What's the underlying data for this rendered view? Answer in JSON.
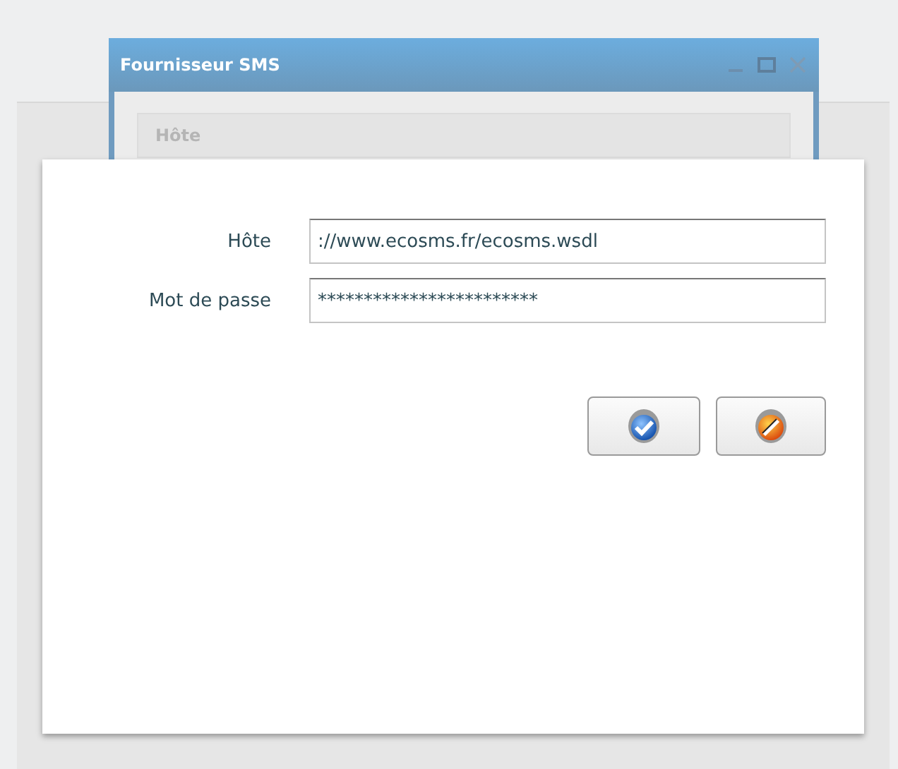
{
  "background_window": {
    "title": "Fournisseur SMS",
    "field_label": "Hôte"
  },
  "form": {
    "fields": [
      {
        "label": "Hôte",
        "value": "://www.ecosms.fr/ecosms.wsdl"
      },
      {
        "label": "Mot de passe",
        "value": "************************"
      }
    ]
  },
  "buttons": [
    {
      "kind": "confirm"
    },
    {
      "kind": "cancel"
    }
  ]
}
